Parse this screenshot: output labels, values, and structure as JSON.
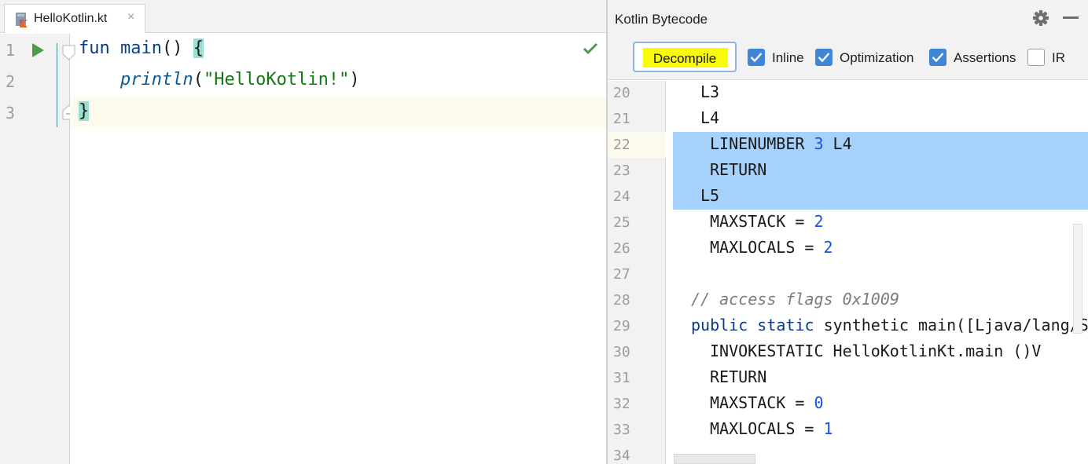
{
  "editor": {
    "tab": {
      "title": "HelloKotlin.kt",
      "close": "×"
    },
    "line_numbers": [
      "1",
      "2",
      "3"
    ],
    "code": {
      "line1": {
        "kw": "fun",
        "name": "main",
        "parens": "() ",
        "brace": "{"
      },
      "line2": {
        "call": "println",
        "open": "(",
        "string": "\"HelloKotlin!\"",
        "close": ")"
      },
      "line3": {
        "brace": "}"
      }
    }
  },
  "bytecode_panel": {
    "title": "Kotlin Bytecode",
    "toolbar": {
      "decompile_label": "Decompile",
      "options": [
        {
          "label": "Inline",
          "checked": true
        },
        {
          "label": "Optimization",
          "checked": true
        },
        {
          "label": "Assertions",
          "checked": true
        },
        {
          "label": "IR",
          "checked": false
        }
      ]
    },
    "line_numbers": [
      "20",
      "21",
      "22",
      "23",
      "24",
      "25",
      "26",
      "27",
      "28",
      "29",
      "30",
      "31",
      "32",
      "33",
      "34"
    ],
    "lines": {
      "l20": "L3",
      "l21": "L4",
      "l22a": "LINENUMBER ",
      "l22n": "3",
      "l22b": " L4",
      "l23": "RETURN",
      "l24": "L5",
      "l25a": "MAXSTACK = ",
      "l25n": "2",
      "l26a": "MAXLOCALS = ",
      "l26n": "2",
      "l28": "// access flags 0x1009",
      "l29kw1": "public",
      "l29kw2": "static",
      "l29rest": " synthetic main([Ljava/lang/S",
      "l30": "INVOKESTATIC HelloKotlinKt.main ()V",
      "l31": "RETURN",
      "l32a": "MAXSTACK = ",
      "l32n": "0",
      "l33a": "MAXLOCALS = ",
      "l33n": "1"
    }
  },
  "colors": {
    "selection": "#a6d1fa",
    "checkbox": "#3f87d6",
    "highlight": "#f9f90a",
    "brace_match": "#99dfd4"
  }
}
